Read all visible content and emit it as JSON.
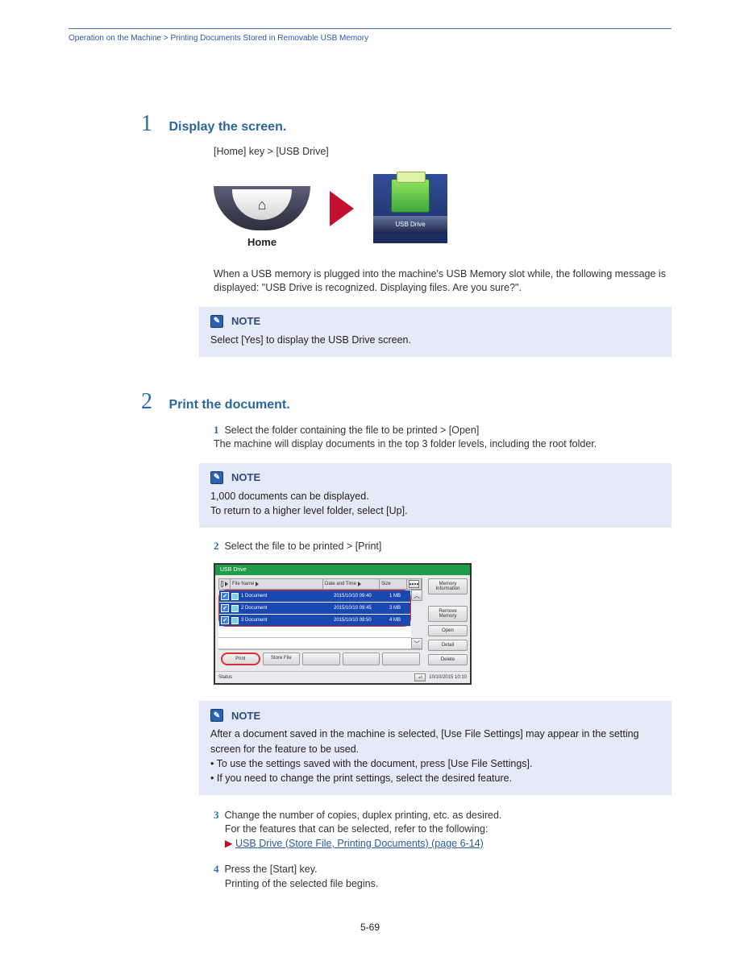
{
  "header": {
    "left": "Operation on the Machine > Printing Documents Stored in Removable USB Memory",
    "right": ""
  },
  "steps": {
    "s1": {
      "num": "1",
      "title": "Display the screen."
    },
    "s2": {
      "num": "2",
      "title": "Print the document."
    }
  },
  "home_label": "Home",
  "app_label": "USB Drive",
  "pre_note_1": "[Home] key > [USB Drive]",
  "pre_note_2": "When a USB memory is plugged into the machine's USB Memory slot while, the following message is displayed: \"USB Drive is recognized. Displaying files. Are you sure?\".",
  "step1_body": "Select the folder containing the file to be printed > [Open]\nThe machine will display documents in the top 3 folder levels, including the root folder.",
  "note1_title": "NOTE",
  "note1_body_a": "1,000 documents can be displayed.",
  "note1_body_b": "To return to a higher level folder, select [Up].",
  "step2_instr": "Select the file to be printed > [Print]",
  "screenshot": {
    "title_left": "USB Drive",
    "title_right": "",
    "cols": {
      "name": "File Name",
      "date": "Date and Time",
      "size": "Size"
    },
    "rows": [
      {
        "name": "1 Document",
        "date": "2015/10/10 09:40",
        "size": "1 MB"
      },
      {
        "name": "2 Document",
        "date": "2015/10/10 09:45",
        "size": "3 MB"
      },
      {
        "name": "3 Document",
        "date": "2015/10/10 09:50",
        "size": "4 MB"
      }
    ],
    "side_buttons": [
      "Memory Information",
      "Remove Memory",
      "Open",
      "Detail",
      "Delete"
    ],
    "footer_buttons": [
      "Print",
      "Store File",
      "",
      "",
      ""
    ],
    "status_left": "Status",
    "status_date": "10/10/2015   10:10"
  },
  "note2_title": "NOTE",
  "note2_body": "After a document saved in the machine is selected, [Use File Settings] may appear in the setting screen for the feature to be used.",
  "note2_bul_a": "To use the settings saved with the document, press [Use File Settings].",
  "note2_bul_b": "If you need to change the print settings, select the desired feature.",
  "step3_num": "3",
  "step3a": "Change the number of copies, duplex printing, etc. as desired.",
  "step3b": "For the features that can be selected, refer to the following:",
  "step3_link": "USB Drive (Store File, Printing Documents) (page 6-14)",
  "step4_num": "4",
  "step4a": "Press the [Start] key.",
  "step4b": "Printing of the selected file begins.",
  "page_number": "5-69"
}
